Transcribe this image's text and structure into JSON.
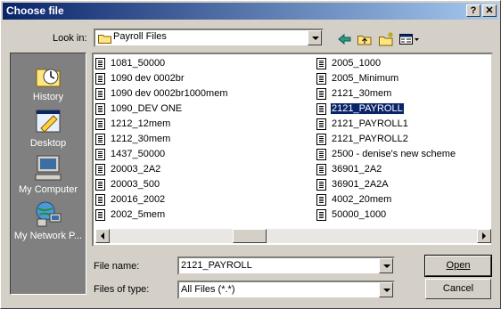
{
  "window": {
    "title": "Choose file",
    "help_label": "?",
    "close_label": "✕"
  },
  "lookin": {
    "label": "Look in:",
    "value": "Payroll Files"
  },
  "places": [
    {
      "label": "History"
    },
    {
      "label": "Desktop"
    },
    {
      "label": "My Computer"
    },
    {
      "label": "My Network P..."
    }
  ],
  "files": {
    "col1": [
      "1081_50000",
      "1090 dev 0002br",
      "1090 dev 0002br1000mem",
      "1090_DEV ONE",
      "1212_12mem",
      "1212_30mem",
      "1437_50000",
      "20003_2A2",
      "20003_500",
      "20016_2002",
      "2002_5mem"
    ],
    "col2": [
      "2005_1000",
      "2005_Minimum",
      "2121_30mem",
      "2121_PAYROLL",
      "2121_PAYROLL1",
      "2121_PAYROLL2",
      "2500 - denise's new scheme",
      "36901_2A2",
      "36901_2A2A",
      "4002_20mem",
      "50000_1000"
    ],
    "selected": "2121_PAYROLL"
  },
  "filename": {
    "label": "File name:",
    "value": "2121_PAYROLL"
  },
  "filetype": {
    "label": "Files of type:",
    "value": "All Files (*.*)"
  },
  "buttons": {
    "open": "Open",
    "cancel": "Cancel"
  },
  "colors": {
    "title_start": "#0a246a",
    "title_end": "#a6caf0",
    "selection": "#0a246a",
    "face": "#d4d0c8"
  }
}
